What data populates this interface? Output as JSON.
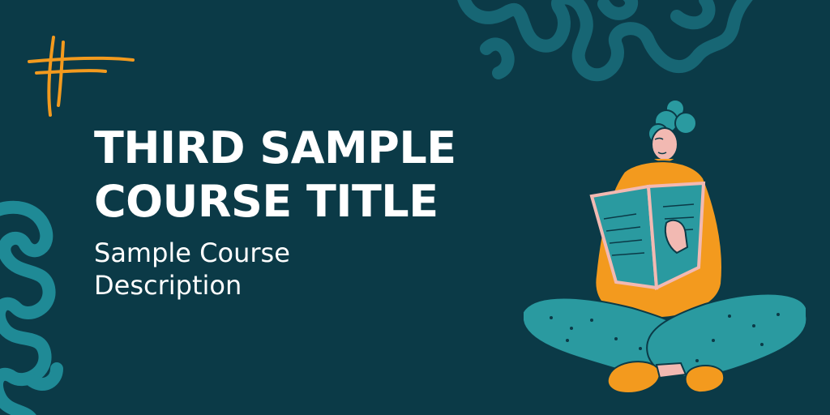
{
  "banner": {
    "title_line1": "THIRD SAMPLE",
    "title_line2": "COURSE TITLE",
    "description_line1": "Sample Course",
    "description_line2": "Description"
  },
  "colors": {
    "background": "#0b3a47",
    "teal_squiggle": "#1a7f8c",
    "teal_dark_squiggle": "#176674",
    "accent_orange": "#f39a1e",
    "teal_figure": "#2a9aa0",
    "skin": "#f2b9b2",
    "text": "#ffffff"
  },
  "icons": [
    "hash-mark-icon",
    "reading-person-illustration"
  ]
}
